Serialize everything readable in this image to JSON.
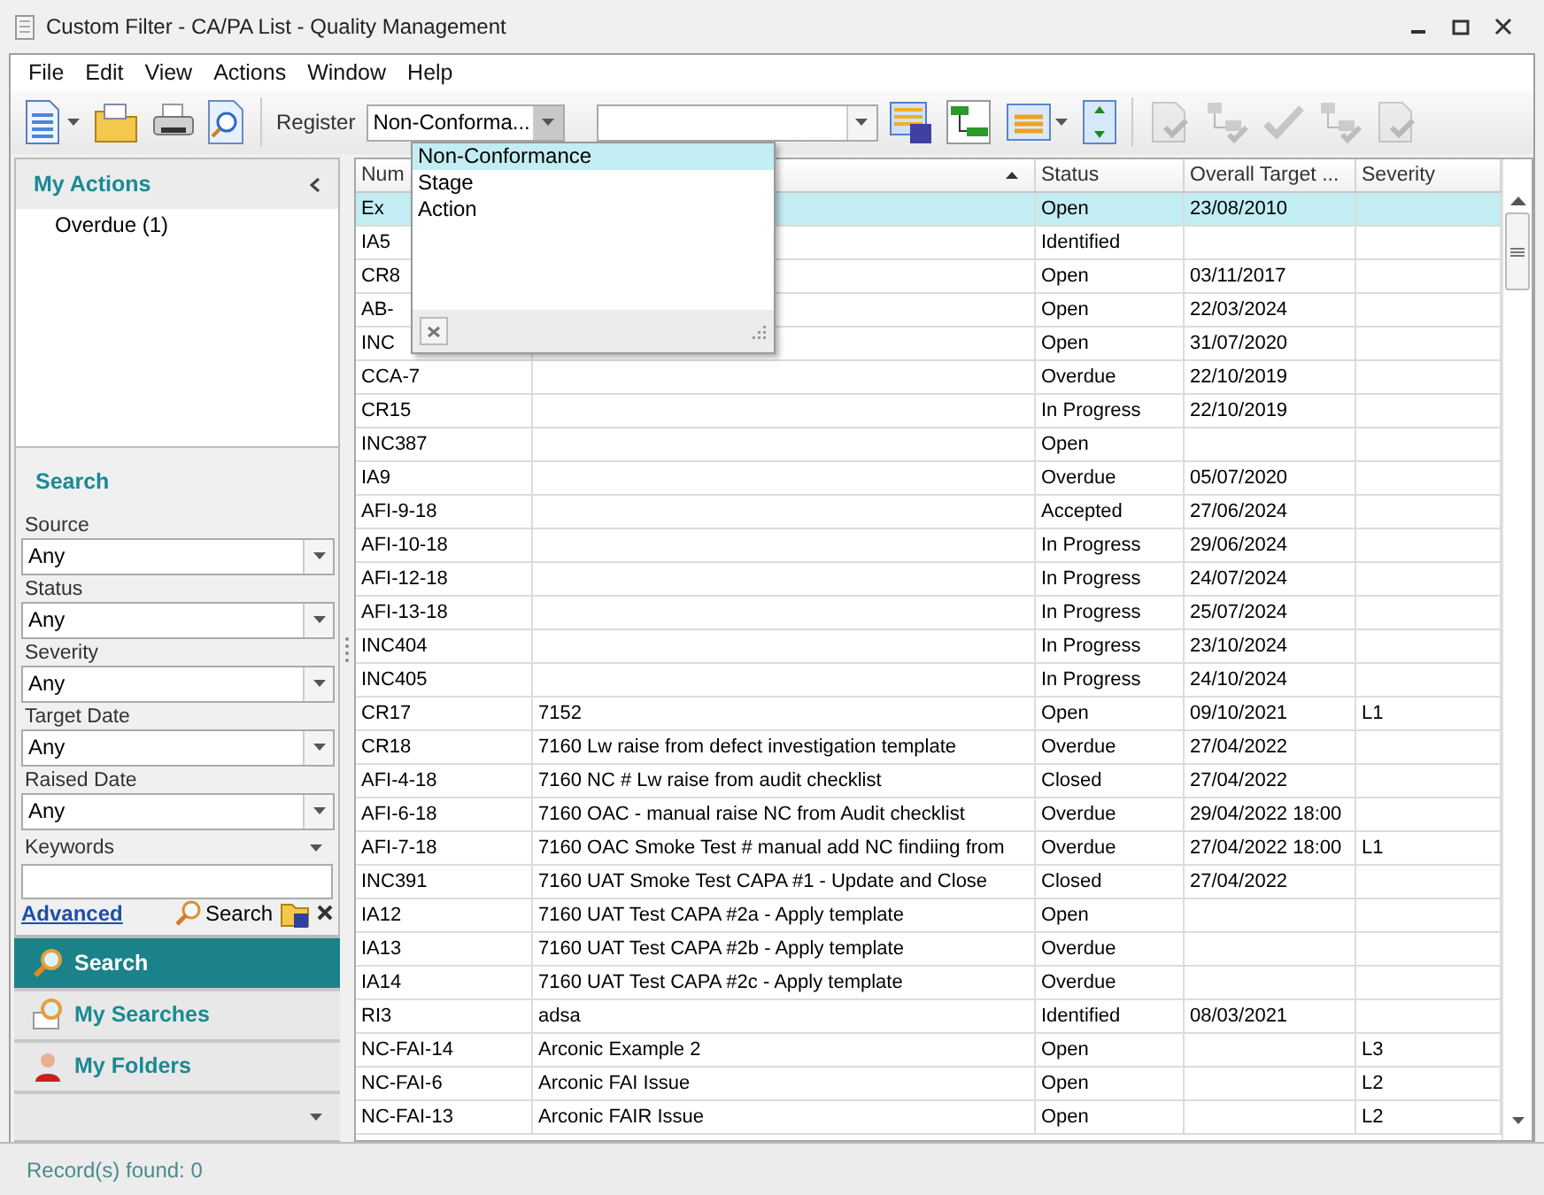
{
  "window": {
    "title": "Custom Filter - CA/PA List - Quality Management"
  },
  "menu": [
    "File",
    "Edit",
    "View",
    "Actions",
    "Window",
    "Help"
  ],
  "toolbar": {
    "register_label": "Register",
    "register_value": "Non-Conforma...",
    "action_buttons_disabled": true,
    "register_options": [
      {
        "label": "Non-Conformance",
        "selected": true
      },
      {
        "label": "Stage",
        "selected": false
      },
      {
        "label": "Action",
        "selected": false
      }
    ]
  },
  "my_actions": {
    "title": "My Actions",
    "items": [
      "Overdue (1)"
    ]
  },
  "search": {
    "title": "Search",
    "fields": [
      {
        "label": "Source",
        "value": "Any"
      },
      {
        "label": "Status",
        "value": "Any"
      },
      {
        "label": "Severity",
        "value": "Any"
      },
      {
        "label": "Target Date",
        "value": "Any"
      },
      {
        "label": "Raised Date",
        "value": "Any"
      }
    ],
    "keywords_label": "Keywords",
    "advanced_link": "Advanced",
    "search_button": "Search"
  },
  "navigation": [
    {
      "label": "Search",
      "selected": true,
      "kind": "search"
    },
    {
      "label": "My Searches",
      "selected": false,
      "kind": "searches"
    },
    {
      "label": "My Folders",
      "selected": false,
      "kind": "folders"
    }
  ],
  "table": {
    "columns": [
      {
        "label": "Num"
      },
      {
        "sorted": true
      },
      {
        "label": "Status"
      },
      {
        "label": "Overall Target ..."
      },
      {
        "label": "Severity"
      }
    ],
    "rows": [
      {
        "number": "Ex",
        "status": "Open",
        "overall_target": "23/08/2010",
        "selected": true
      },
      {
        "number": "IA5",
        "status": "Identified",
        "selected": false
      },
      {
        "number": "CR8",
        "status": "Open",
        "overall_target": "03/11/2017",
        "selected": false
      },
      {
        "number": "AB-",
        "status": "Open",
        "overall_target": "22/03/2024",
        "selected": false
      },
      {
        "number": "INC",
        "status": "Open",
        "overall_target": "31/07/2020",
        "selected": false
      },
      {
        "number": "CCA-7",
        "status": "Overdue",
        "overall_target": "22/10/2019",
        "selected": false
      },
      {
        "number": "CR15",
        "status": "In Progress",
        "overall_target": "22/10/2019",
        "selected": false
      },
      {
        "number": "INC387",
        "status": "Open",
        "selected": false
      },
      {
        "number": "IA9",
        "status": "Overdue",
        "overall_target": "05/07/2020",
        "selected": false
      },
      {
        "number": "AFI-9-18",
        "status": "Accepted",
        "overall_target": "27/06/2024",
        "selected": false
      },
      {
        "number": "AFI-10-18",
        "status": "In Progress",
        "overall_target": "29/06/2024",
        "selected": false
      },
      {
        "number": "AFI-12-18",
        "status": "In Progress",
        "overall_target": "24/07/2024",
        "selected": false
      },
      {
        "number": "AFI-13-18",
        "status": "In Progress",
        "overall_target": "25/07/2024",
        "selected": false
      },
      {
        "number": "INC404",
        "status": "In Progress",
        "overall_target": "23/10/2024",
        "selected": false
      },
      {
        "number": "INC405",
        "status": "In Progress",
        "overall_target": "24/10/2024",
        "selected": false
      },
      {
        "number": "CR17",
        "column_2": "7152",
        "status": "Open",
        "overall_target": "09/10/2021",
        "severity": "L1",
        "selected": false
      },
      {
        "number": "CR18",
        "column_2": "7160 Lw raise from defect investigation template",
        "status": "Overdue",
        "overall_target": "27/04/2022",
        "selected": false
      },
      {
        "number": "AFI-4-18",
        "column_2": "7160 NC # Lw raise from audit checklist",
        "status": "Closed",
        "overall_target": "27/04/2022",
        "selected": false
      },
      {
        "number": "AFI-6-18",
        "column_2": "7160 OAC  - manual raise NC from Audit checklist",
        "status": "Overdue",
        "overall_target": "29/04/2022 18:00",
        "selected": false
      },
      {
        "number": "AFI-7-18",
        "column_2": "7160 OAC Smoke Test # manual add NC findiing from",
        "status": "Overdue",
        "overall_target": "27/04/2022 18:00",
        "severity": "L1",
        "selected": false
      },
      {
        "number": "INC391",
        "column_2": "7160 UAT Smoke Test CAPA #1 - Update and Close",
        "status": "Closed",
        "overall_target": "27/04/2022",
        "selected": false
      },
      {
        "number": "IA12",
        "column_2": "7160 UAT Test CAPA #2a - Apply template",
        "status": "Open",
        "selected": false
      },
      {
        "number": "IA13",
        "column_2": "7160 UAT Test CAPA #2b - Apply template",
        "status": "Overdue",
        "selected": false
      },
      {
        "number": "IA14",
        "column_2": "7160 UAT Test CAPA #2c - Apply template",
        "status": "Overdue",
        "selected": false
      },
      {
        "number": "RI3",
        "column_2": "adsa",
        "status": "Identified",
        "overall_target": "08/03/2021",
        "selected": false
      },
      {
        "number": "NC-FAI-14",
        "column_2": "Arconic Example 2",
        "status": "Open",
        "severity": "L3",
        "selected": false
      },
      {
        "number": "NC-FAI-6",
        "column_2": "Arconic FAI Issue",
        "status": "Open",
        "severity": "L2",
        "selected": false
      },
      {
        "number": "NC-FAI-13",
        "column_2": "Arconic FAIR Issue",
        "status": "Open",
        "severity": "L2",
        "selected": false
      }
    ]
  },
  "status_bar": "Record(s) found: 0"
}
